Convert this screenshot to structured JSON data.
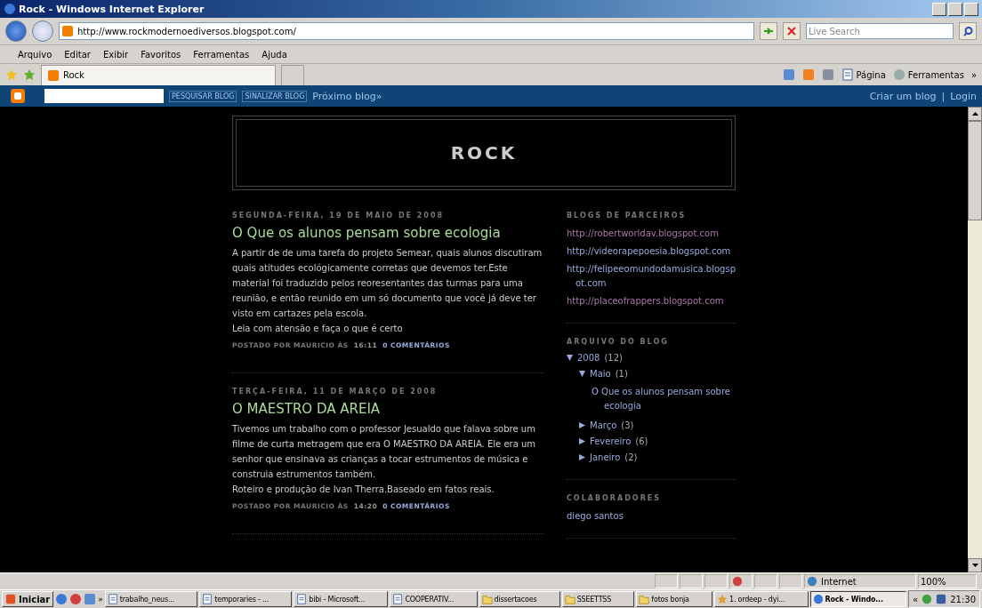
{
  "window": {
    "title": "Rock - Windows Internet Explorer"
  },
  "address_bar": {
    "url": "http://www.rockmodernoediversos.blogspot.com/",
    "search_placeholder": "Live Search"
  },
  "menu": [
    "Arquivo",
    "Editar",
    "Exibir",
    "Favoritos",
    "Ferramentas",
    "Ajuda"
  ],
  "tabs": [
    {
      "label": "Rock",
      "selected": true
    }
  ],
  "command_bar": [
    {
      "label": "Página",
      "kind": "page"
    },
    {
      "label": "Ferramentas",
      "kind": "tools"
    },
    {
      "label": "»",
      "kind": "more"
    }
  ],
  "blogger_bar": {
    "search_button": "PESQUISAR BLOG",
    "flag_button": "SINALIZAR BLOG",
    "next_blog": "Próximo blog»",
    "create_blog": "Criar um blog",
    "separator": "|",
    "login": "Login"
  },
  "blog": {
    "title": "ROCK",
    "posts": [
      {
        "date": "SEGUNDA-FEIRA, 19 DE MAIO DE 2008",
        "title": "O Que os alunos pensam sobre ecologia",
        "paragraphs": [
          "A partir de de uma tarefa do projeto Semear, quais alunos discutiram quais atitudes ecológicamente corretas que devemos ter.Este material foi traduzido pelos reoresentantes das turmas para uma reunião, e então reunido em um só documento que você já deve ter visto em cartazes pela escola.",
          "Leia com atensão e faça o que é certo"
        ],
        "byline": "POSTADO POR MAURICIO ÀS",
        "time": "16:11",
        "comments": "0 COMENTÁRIOS"
      },
      {
        "date": "TERÇA-FEIRA, 11 DE MARÇO DE 2008",
        "title": "O MAESTRO DA AREIA",
        "paragraphs": [
          "Tivemos um trabalho com o professor Jesualdo que falava sobre um filme de curta metragem que era O MAESTRO DA AREIA. Ele era um senhor que ensinava as crianças a tocar estrumentos de música e construia estrumentos também.",
          "Roteiro e produção de Ivan Therra.Baseado em fatos reais."
        ],
        "byline": "POSTADO POR MAURICIO ÀS",
        "time": "14:20",
        "comments": "0 COMENTÁRIOS"
      }
    ],
    "sidebar": [
      {
        "kind": "links",
        "heading": "BLOGS DE PARCEIROS",
        "items": [
          {
            "label": "http://robertworldav.blogspot.com",
            "visited": true
          },
          {
            "label": "http://videorapepoesia.blogspot.com",
            "visited": false
          },
          {
            "label": "http://felipeeomundodamusica.blogspot.com",
            "visited": false
          },
          {
            "label": "http://placeofrappers.blogspot.com",
            "visited": true
          }
        ]
      },
      {
        "kind": "archive",
        "heading": "ARQUIVO DO BLOG",
        "items": [
          {
            "label": "2008",
            "count": "(12)",
            "expanded": true,
            "children": [
              {
                "label": "Maio",
                "count": "(1)",
                "expanded": true,
                "children": [
                  {
                    "label": "O Que os alunos pensam sobre ecologia"
                  }
                ]
              },
              {
                "label": "Março",
                "count": "(3)",
                "expanded": false
              },
              {
                "label": "Fevereiro",
                "count": "(6)",
                "expanded": false
              },
              {
                "label": "Janeiro",
                "count": "(2)",
                "expanded": false
              }
            ]
          }
        ]
      },
      {
        "kind": "links",
        "heading": "COLABORADORES",
        "items": [
          {
            "label": "diego santos",
            "visited": false
          }
        ]
      }
    ]
  },
  "status_bar": {
    "zone": "Internet",
    "zoom": "100%"
  },
  "taskbar": {
    "start": "Iniciar",
    "more": "»",
    "tasks": [
      {
        "label": "trabalho_neus...",
        "kind": "doc",
        "selected": false
      },
      {
        "label": "temporaries - ...",
        "kind": "doc",
        "selected": false
      },
      {
        "label": "bibi - Microsoft...",
        "kind": "doc",
        "selected": false
      },
      {
        "label": "COOPERATIV...",
        "kind": "doc",
        "selected": false
      },
      {
        "label": "dissertacoes",
        "kind": "folder",
        "selected": false
      },
      {
        "label": "SSEETTSS",
        "kind": "folder",
        "selected": false
      },
      {
        "label": "fotos bonja",
        "kind": "folder",
        "selected": false
      },
      {
        "label": "1. ordeep - dyi...",
        "kind": "app",
        "selected": false
      },
      {
        "label": "Rock - Windo...",
        "kind": "ie",
        "selected": true
      }
    ],
    "tray_toggle": "«",
    "clock": "21:30"
  }
}
